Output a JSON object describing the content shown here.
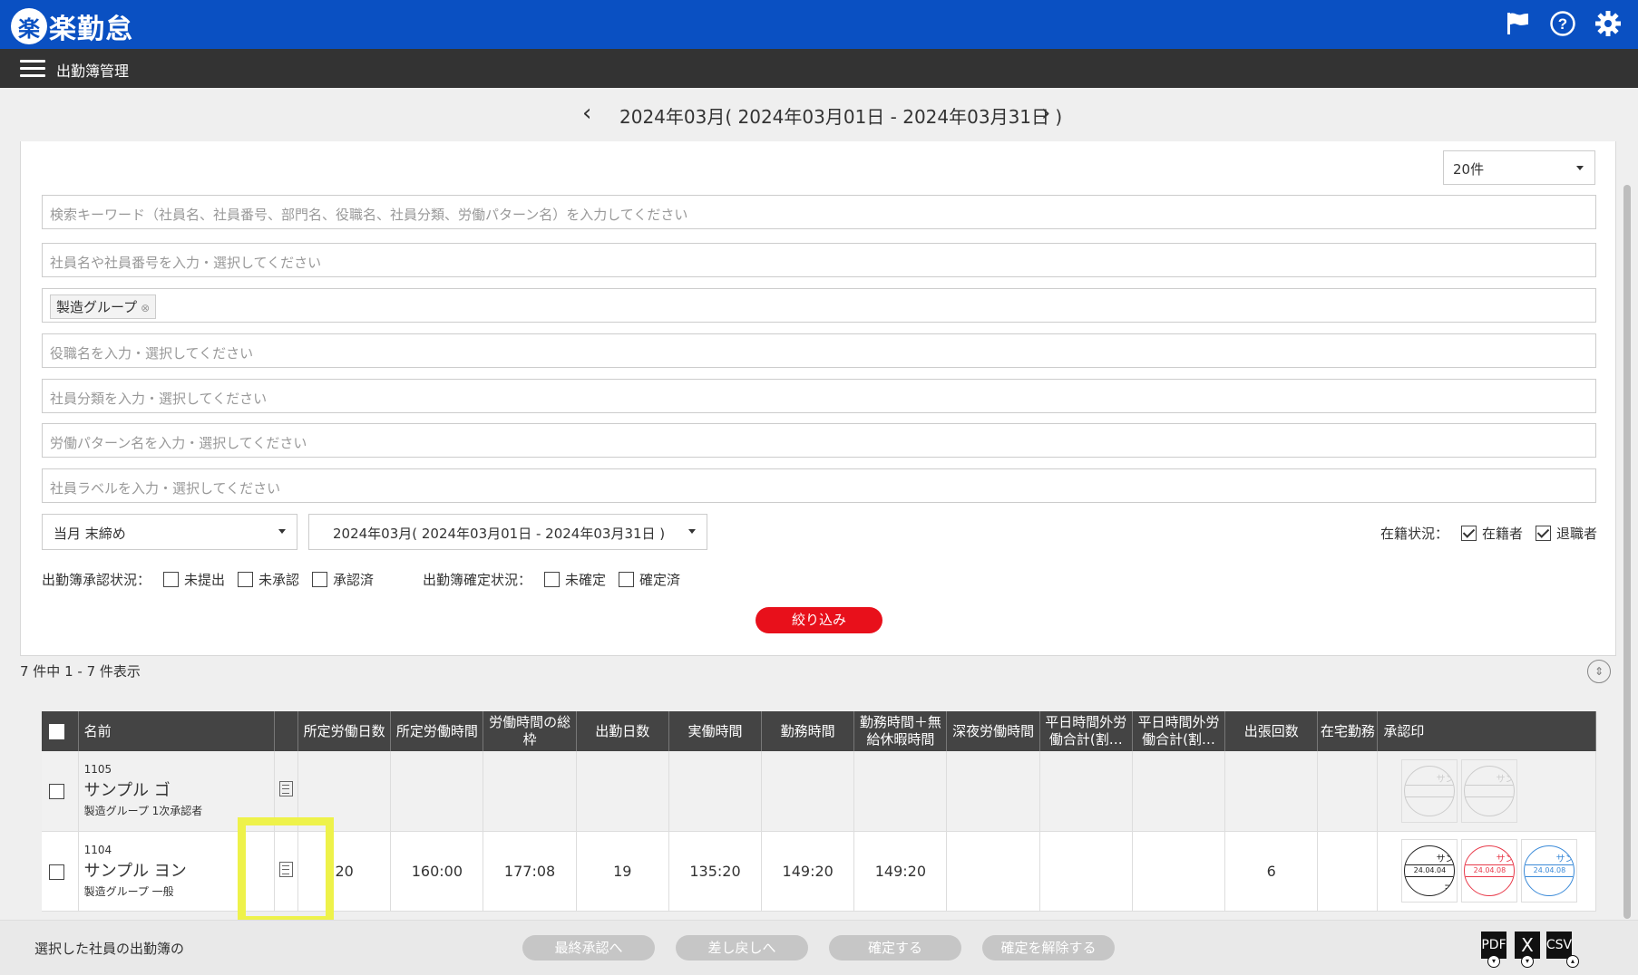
{
  "app": {
    "logo_char": "楽",
    "logo_text": "楽勤怠"
  },
  "header": {
    "page_title": "出勤簿管理"
  },
  "period": {
    "label": "2024年03月( 2024年03月01日 - 2024年03月31日 )"
  },
  "filters": {
    "per_page": "20件",
    "keyword_placeholder": "検索キーワード（社員名、社員番号、部門名、役職名、社員分類、労働パターン名）を入力してください",
    "employee_placeholder": "社員名や社員番号を入力・選択してください",
    "group_tag": "製造グループ",
    "position_placeholder": "役職名を入力・選択してください",
    "category_placeholder": "社員分類を入力・選択してください",
    "pattern_placeholder": "労働パターン名を入力・選択してください",
    "label_placeholder": "社員ラベルを入力・選択してください",
    "closing_select": "当月 末締め",
    "period_select": "2024年03月( 2024年03月01日 - 2024年03月31日 )",
    "enrollment_label": "在籍状況：",
    "enrollment_options": [
      {
        "label": "在籍者",
        "checked": true
      },
      {
        "label": "退職者",
        "checked": true
      }
    ],
    "approval_label": "出勤簿承認状況：",
    "approval_options": [
      {
        "label": "未提出",
        "checked": false
      },
      {
        "label": "未承認",
        "checked": false
      },
      {
        "label": "承認済",
        "checked": false
      }
    ],
    "confirm_label": "出勤簿確定状況：",
    "confirm_options": [
      {
        "label": "未確定",
        "checked": false
      },
      {
        "label": "確定済",
        "checked": false
      }
    ],
    "submit": "絞り込み"
  },
  "results": {
    "count_text": "7 件中 1 - 7 件表示"
  },
  "table": {
    "headers": {
      "name": "名前",
      "c1": "所定労働日数",
      "c2": "所定労働時間",
      "c3a": "労働時間の総",
      "c3b": "枠",
      "c4": "出勤日数",
      "c5": "実働時間",
      "c6": "勤務時間",
      "c7a": "勤務時間＋無",
      "c7b": "給休暇時間",
      "c8": "深夜労働時間",
      "c9a": "平日時間外労",
      "c9b": "働合計(割…",
      "c10a": "平日時間外労",
      "c10b": "働合計(割…",
      "c11": "出張回数",
      "c12": "在宅勤務",
      "c13": "承認印"
    },
    "rows": [
      {
        "no": "1105",
        "name": "サンプル ゴ",
        "group": "製造グループ 1次承認者",
        "c1": "",
        "c2": "",
        "c3": "",
        "c4": "",
        "c5": "",
        "c6": "",
        "c7": "",
        "c8": "",
        "c9": "",
        "c10": "",
        "c11": "",
        "c12": ""
      },
      {
        "no": "1104",
        "name": "サンプル ヨン",
        "group": "製造グループ 一般",
        "c1": "20",
        "c2": "160:00",
        "c3": "177:08",
        "c4": "19",
        "c5": "135:20",
        "c6": "149:20",
        "c7": "149:20",
        "c8": "",
        "c9": "",
        "c10": "",
        "c11": "6",
        "c12": ""
      }
    ],
    "stamps_row1": [
      {
        "top": "サンプル",
        "date": "",
        "bottom": "ゴ"
      },
      {
        "top": "サンプル",
        "date": "",
        "bottom": "ニ"
      }
    ],
    "stamps_row2": [
      {
        "top": "サンプル",
        "date": "24.04.04",
        "bottom": "ヨン"
      },
      {
        "top": "サンプル",
        "date": "24.04.08",
        "bottom": "ゴ"
      },
      {
        "top": "サンプル",
        "date": "24.04.08",
        "bottom": "ニ"
      }
    ]
  },
  "bottom": {
    "text": "選択した社員の出勤簿の",
    "buttons": [
      "最終承認へ",
      "差し戻しへ",
      "確定する",
      "確定を解除する"
    ],
    "exports": [
      "PDF",
      "X",
      "CSV"
    ]
  },
  "colors": {
    "brand": "#0a50c2",
    "accent_red": "#e8101b",
    "highlight": "#eef24a"
  },
  "icons": [
    "flag-icon",
    "help-icon",
    "gear-icon",
    "menu-icon",
    "document-icon",
    "collapse-icon"
  ]
}
